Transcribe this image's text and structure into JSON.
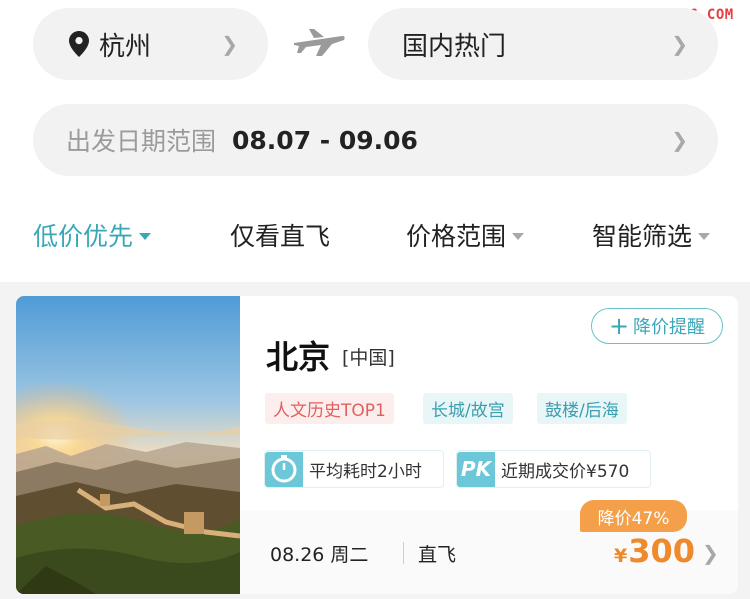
{
  "watermark": "CPQG.COM",
  "search": {
    "origin": "杭州",
    "destination": "国内热门",
    "date_label": "出发日期范围",
    "date_range": "08.07 - 09.06"
  },
  "filters": [
    {
      "label": "低价优先",
      "active": true,
      "has_caret": true
    },
    {
      "label": "仅看直飞",
      "active": false,
      "has_caret": false
    },
    {
      "label": "价格范围",
      "active": false,
      "has_caret": true
    },
    {
      "label": "智能筛选",
      "active": false,
      "has_caret": true
    }
  ],
  "result": {
    "city": "北京",
    "country": "[中国]",
    "remind_label": "降价提醒",
    "tags": [
      "人文历史TOP1",
      "长城/故宫",
      "鼓楼/后海"
    ],
    "avg_time": "平均耗时2小时",
    "pk_badge": "PK",
    "recent_price": "近期成交价¥570",
    "date": "08.26 周二",
    "flight_type": "直飞",
    "discount": "降价47%",
    "price_symbol": "¥",
    "price": "300"
  },
  "colors": {
    "accent": "#3aa7b8",
    "price": "#ee8a2c",
    "discount_bg": "#f4a04a",
    "tag_red": "#e06060"
  },
  "icons": [
    "location-pin-icon",
    "airplane-icon",
    "chevron-right-icon",
    "plus-icon",
    "stopwatch-icon",
    "caret-down-icon"
  ]
}
